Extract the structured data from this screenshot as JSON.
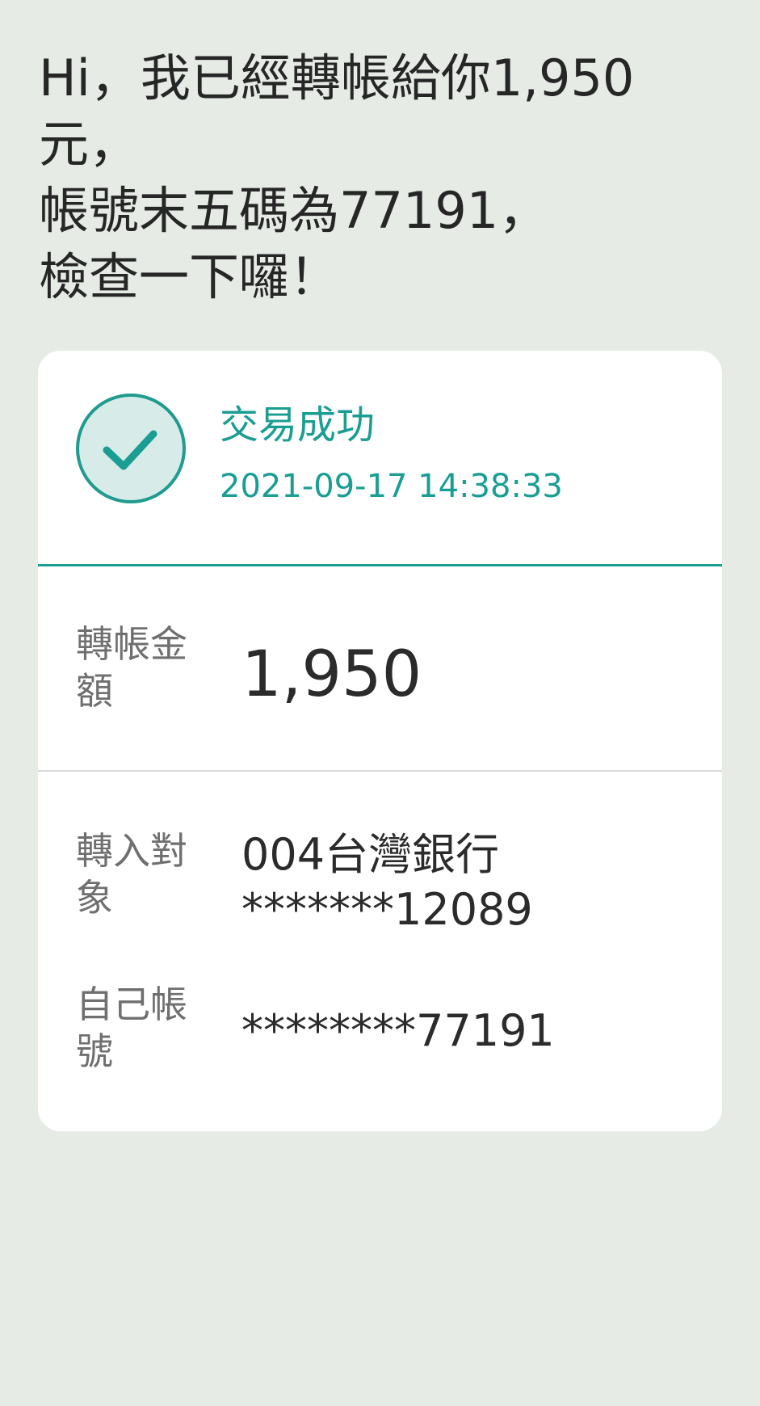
{
  "message": {
    "lines": [
      "Hi，我已經轉帳給你1,950",
      "元，",
      "帳號末五碼為77191，",
      "檢查一下囉！"
    ]
  },
  "card": {
    "status_icon": "checkmark-icon",
    "status_title": "交易成功",
    "status_time": "2021-09-17 14:38:33",
    "amount_label": "轉帳金額",
    "amount_value": "1,950",
    "target_label": "轉入對象",
    "target_bank": "004台灣銀行",
    "target_account": "*******12089",
    "own_label": "自己帳號",
    "own_account": "********77191"
  },
  "colors": {
    "background": "#e6ebe6",
    "accent": "#1a9e93",
    "accent_light": "#d7ebe8"
  }
}
